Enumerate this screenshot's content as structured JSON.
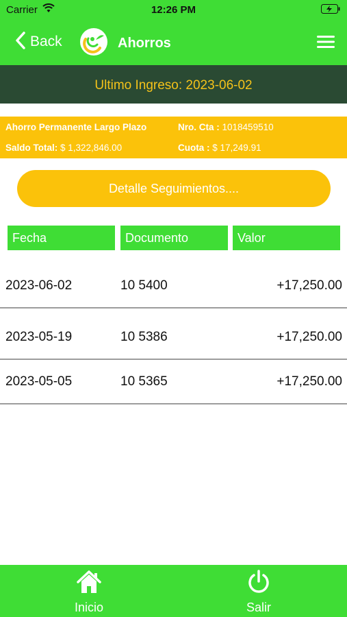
{
  "status_bar": {
    "carrier": "Carrier",
    "time": "12:26 PM"
  },
  "nav": {
    "back_label": "Back",
    "title": "Ahorros"
  },
  "banner": {
    "text": "Ultimo Ingreso: 2023-06-02"
  },
  "account": {
    "name": "Ahorro Permanente Largo Plazo",
    "nro_label": "Nro. Cta :",
    "nro_value": "1018459510",
    "saldo_label": "Saldo Total:",
    "saldo_value": "$ 1,322,846.00",
    "cuota_label": "Cuota :",
    "cuota_value": "$ 17,249.91"
  },
  "detail_button": {
    "label": "Detalle Seguimientos...."
  },
  "table": {
    "headers": [
      "Fecha",
      "Documento",
      "Valor"
    ],
    "rows": [
      {
        "fecha": "2023-06-02",
        "documento": "10 5400",
        "valor": "+17,250.00"
      },
      {
        "fecha": "2023-05-19",
        "documento": "10 5386",
        "valor": "+17,250.00"
      },
      {
        "fecha": "2023-05-05",
        "documento": "10 5365",
        "valor": "+17,250.00"
      }
    ]
  },
  "tab_bar": {
    "inicio_label": "Inicio",
    "salir_label": "Salir"
  },
  "colors": {
    "green": "#3fdd35",
    "yellow": "#fbc20a",
    "dark_green": "#2a4a33",
    "banner_text": "#f4c21a"
  }
}
